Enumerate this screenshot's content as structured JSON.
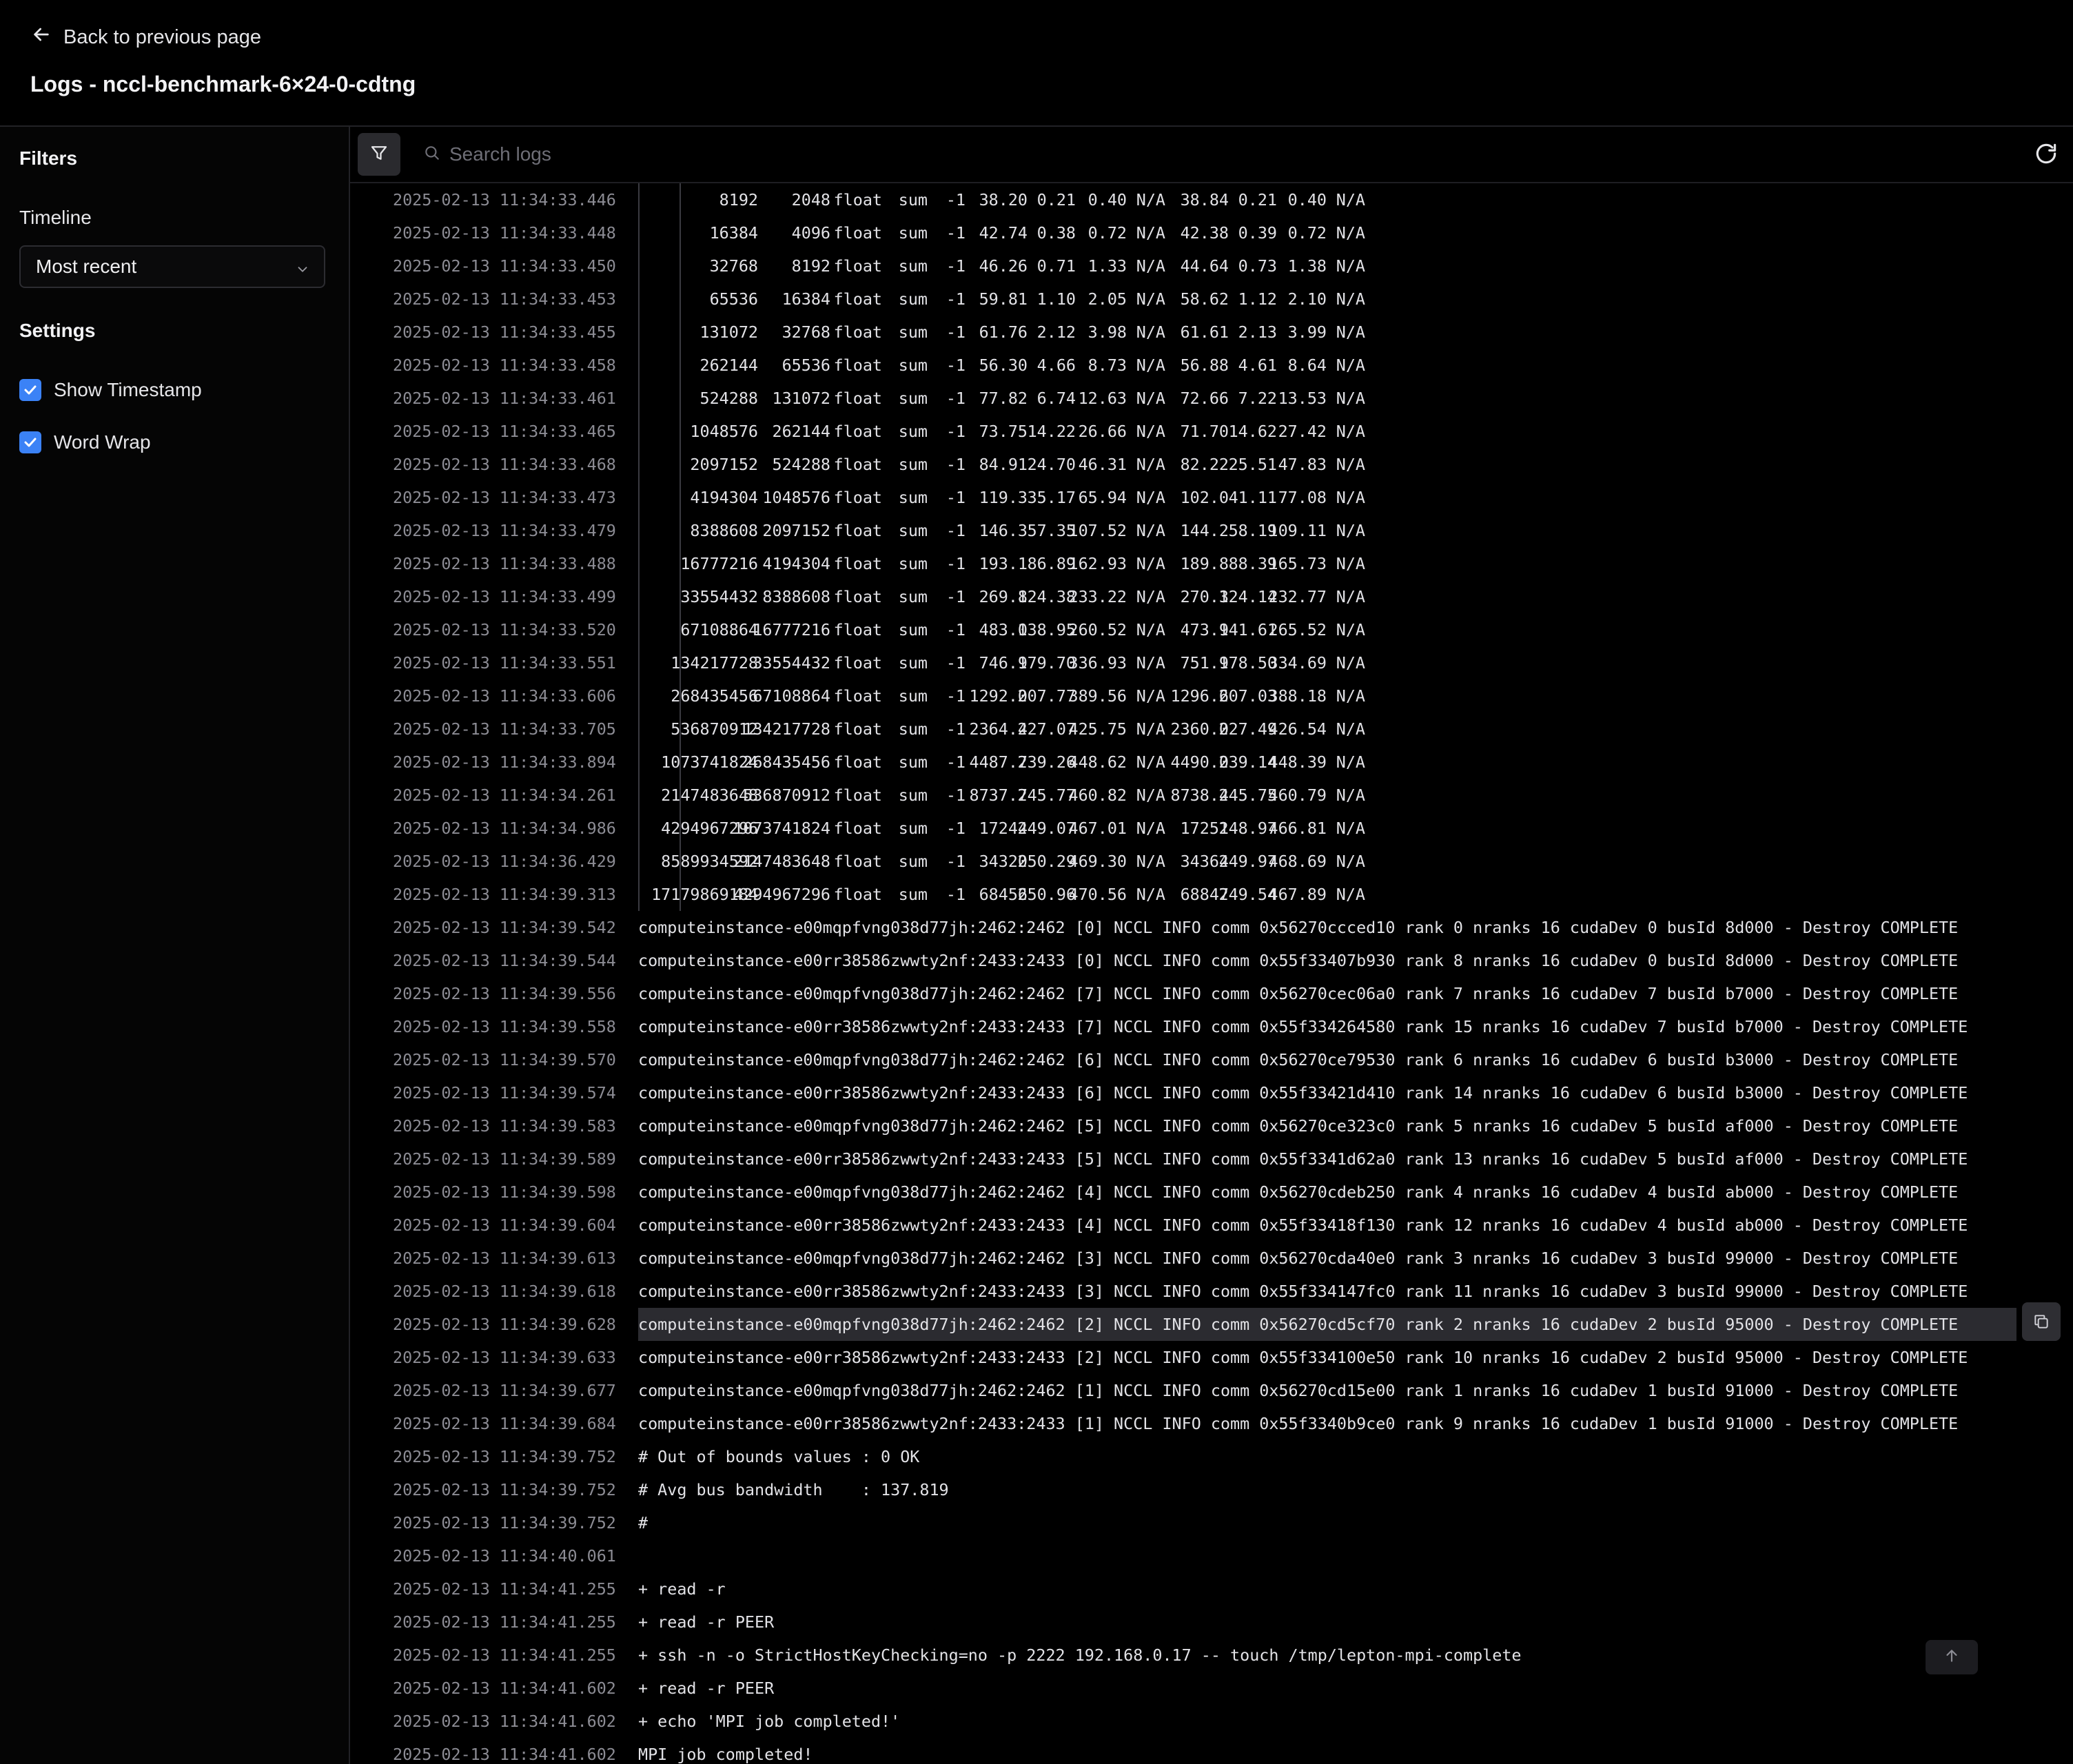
{
  "header": {
    "back_label": "Back to previous page",
    "title": "Logs - nccl-benchmark-6×24-0-cdtng"
  },
  "sidebar": {
    "filters_heading": "Filters",
    "timeline_label": "Timeline",
    "timeline_value": "Most recent",
    "settings_heading": "Settings",
    "show_timestamp": {
      "label": "Show Timestamp",
      "checked": true
    },
    "word_wrap": {
      "label": "Word Wrap",
      "checked": true
    }
  },
  "toolbar": {
    "search_placeholder": "Search logs"
  },
  "icons": [
    "arrow-left-icon",
    "chevron-down-icon",
    "check-icon",
    "filter-icon",
    "search-icon",
    "refresh-icon",
    "copy-icon",
    "arrow-up-icon"
  ],
  "colors": {
    "accent": "#3b82f6",
    "background": "#000000",
    "highlight": "#2b2b30"
  },
  "log_table_rows": [
    [
      "2025-02-13 11:34:33.446",
      "8192",
      "2048",
      "float",
      "sum",
      "-1",
      "38.20",
      "0.21",
      "0.40",
      "N/A",
      "38.84",
      "0.21",
      "0.40",
      "N/A"
    ],
    [
      "2025-02-13 11:34:33.448",
      "16384",
      "4096",
      "float",
      "sum",
      "-1",
      "42.74",
      "0.38",
      "0.72",
      "N/A",
      "42.38",
      "0.39",
      "0.72",
      "N/A"
    ],
    [
      "2025-02-13 11:34:33.450",
      "32768",
      "8192",
      "float",
      "sum",
      "-1",
      "46.26",
      "0.71",
      "1.33",
      "N/A",
      "44.64",
      "0.73",
      "1.38",
      "N/A"
    ],
    [
      "2025-02-13 11:34:33.453",
      "65536",
      "16384",
      "float",
      "sum",
      "-1",
      "59.81",
      "1.10",
      "2.05",
      "N/A",
      "58.62",
      "1.12",
      "2.10",
      "N/A"
    ],
    [
      "2025-02-13 11:34:33.455",
      "131072",
      "32768",
      "float",
      "sum",
      "-1",
      "61.76",
      "2.12",
      "3.98",
      "N/A",
      "61.61",
      "2.13",
      "3.99",
      "N/A"
    ],
    [
      "2025-02-13 11:34:33.458",
      "262144",
      "65536",
      "float",
      "sum",
      "-1",
      "56.30",
      "4.66",
      "8.73",
      "N/A",
      "56.88",
      "4.61",
      "8.64",
      "N/A"
    ],
    [
      "2025-02-13 11:34:33.461",
      "524288",
      "131072",
      "float",
      "sum",
      "-1",
      "77.82",
      "6.74",
      "12.63",
      "N/A",
      "72.66",
      "7.22",
      "13.53",
      "N/A"
    ],
    [
      "2025-02-13 11:34:33.465",
      "1048576",
      "262144",
      "float",
      "sum",
      "-1",
      "73.75",
      "14.22",
      "26.66",
      "N/A",
      "71.70",
      "14.62",
      "27.42",
      "N/A"
    ],
    [
      "2025-02-13 11:34:33.468",
      "2097152",
      "524288",
      "float",
      "sum",
      "-1",
      "84.91",
      "24.70",
      "46.31",
      "N/A",
      "82.22",
      "25.51",
      "47.83",
      "N/A"
    ],
    [
      "2025-02-13 11:34:33.473",
      "4194304",
      "1048576",
      "float",
      "sum",
      "-1",
      "119.3",
      "35.17",
      "65.94",
      "N/A",
      "102.0",
      "41.11",
      "77.08",
      "N/A"
    ],
    [
      "2025-02-13 11:34:33.479",
      "8388608",
      "2097152",
      "float",
      "sum",
      "-1",
      "146.3",
      "57.35",
      "107.52",
      "N/A",
      "144.2",
      "58.19",
      "109.11",
      "N/A"
    ],
    [
      "2025-02-13 11:34:33.488",
      "16777216",
      "4194304",
      "float",
      "sum",
      "-1",
      "193.1",
      "86.89",
      "162.93",
      "N/A",
      "189.8",
      "88.39",
      "165.73",
      "N/A"
    ],
    [
      "2025-02-13 11:34:33.499",
      "33554432",
      "8388608",
      "float",
      "sum",
      "-1",
      "269.8",
      "124.38",
      "233.22",
      "N/A",
      "270.3",
      "124.14",
      "232.77",
      "N/A"
    ],
    [
      "2025-02-13 11:34:33.520",
      "67108864",
      "16777216",
      "float",
      "sum",
      "-1",
      "483.0",
      "138.95",
      "260.52",
      "N/A",
      "473.9",
      "141.61",
      "265.52",
      "N/A"
    ],
    [
      "2025-02-13 11:34:33.551",
      "134217728",
      "33554432",
      "float",
      "sum",
      "-1",
      "746.9",
      "179.70",
      "336.93",
      "N/A",
      "751.9",
      "178.50",
      "334.69",
      "N/A"
    ],
    [
      "2025-02-13 11:34:33.606",
      "268435456",
      "67108864",
      "float",
      "sum",
      "-1",
      "1292.0",
      "207.77",
      "389.56",
      "N/A",
      "1296.6",
      "207.03",
      "388.18",
      "N/A"
    ],
    [
      "2025-02-13 11:34:33.705",
      "536870912",
      "134217728",
      "float",
      "sum",
      "-1",
      "2364.4",
      "227.07",
      "425.75",
      "N/A",
      "2360.0",
      "227.49",
      "426.54",
      "N/A"
    ],
    [
      "2025-02-13 11:34:33.894",
      "1073741824",
      "268435456",
      "float",
      "sum",
      "-1",
      "4487.7",
      "239.26",
      "448.62",
      "N/A",
      "4490.0",
      "239.14",
      "448.39",
      "N/A"
    ],
    [
      "2025-02-13 11:34:34.261",
      "2147483648",
      "536870912",
      "float",
      "sum",
      "-1",
      "8737.7",
      "245.77",
      "460.82",
      "N/A",
      "8738.4",
      "245.75",
      "460.79",
      "N/A"
    ],
    [
      "2025-02-13 11:34:34.986",
      "4294967296",
      "1073741824",
      "float",
      "sum",
      "-1",
      "17244",
      "249.07",
      "467.01",
      "N/A",
      "17251",
      "248.97",
      "466.81",
      "N/A"
    ],
    [
      "2025-02-13 11:34:36.429",
      "8589934592",
      "2147483648",
      "float",
      "sum",
      "-1",
      "34320",
      "250.29",
      "469.30",
      "N/A",
      "34364",
      "249.97",
      "468.69",
      "N/A"
    ],
    [
      "2025-02-13 11:34:39.313",
      "17179869184",
      "4294967296",
      "float",
      "sum",
      "-1",
      "68456",
      "250.96",
      "470.56",
      "N/A",
      "68847",
      "249.54",
      "467.89",
      "N/A"
    ]
  ],
  "log_text_rows": [
    [
      "2025-02-13 11:34:39.542",
      "computeinstance-e00mqpfvng038d77jh:2462:2462 [0] NCCL INFO comm 0x56270ccced10 rank 0 nranks 16 cudaDev 0 busId 8d000 - Destroy COMPLETE"
    ],
    [
      "2025-02-13 11:34:39.544",
      "computeinstance-e00rr38586zwwty2nf:2433:2433 [0] NCCL INFO comm 0x55f33407b930 rank 8 nranks 16 cudaDev 0 busId 8d000 - Destroy COMPLETE"
    ],
    [
      "2025-02-13 11:34:39.556",
      "computeinstance-e00mqpfvng038d77jh:2462:2462 [7] NCCL INFO comm 0x56270cec06a0 rank 7 nranks 16 cudaDev 7 busId b7000 - Destroy COMPLETE"
    ],
    [
      "2025-02-13 11:34:39.558",
      "computeinstance-e00rr38586zwwty2nf:2433:2433 [7] NCCL INFO comm 0x55f334264580 rank 15 nranks 16 cudaDev 7 busId b7000 - Destroy COMPLETE"
    ],
    [
      "2025-02-13 11:34:39.570",
      "computeinstance-e00mqpfvng038d77jh:2462:2462 [6] NCCL INFO comm 0x56270ce79530 rank 6 nranks 16 cudaDev 6 busId b3000 - Destroy COMPLETE"
    ],
    [
      "2025-02-13 11:34:39.574",
      "computeinstance-e00rr38586zwwty2nf:2433:2433 [6] NCCL INFO comm 0x55f33421d410 rank 14 nranks 16 cudaDev 6 busId b3000 - Destroy COMPLETE"
    ],
    [
      "2025-02-13 11:34:39.583",
      "computeinstance-e00mqpfvng038d77jh:2462:2462 [5] NCCL INFO comm 0x56270ce323c0 rank 5 nranks 16 cudaDev 5 busId af000 - Destroy COMPLETE"
    ],
    [
      "2025-02-13 11:34:39.589",
      "computeinstance-e00rr38586zwwty2nf:2433:2433 [5] NCCL INFO comm 0x55f3341d62a0 rank 13 nranks 16 cudaDev 5 busId af000 - Destroy COMPLETE"
    ],
    [
      "2025-02-13 11:34:39.598",
      "computeinstance-e00mqpfvng038d77jh:2462:2462 [4] NCCL INFO comm 0x56270cdeb250 rank 4 nranks 16 cudaDev 4 busId ab000 - Destroy COMPLETE"
    ],
    [
      "2025-02-13 11:34:39.604",
      "computeinstance-e00rr38586zwwty2nf:2433:2433 [4] NCCL INFO comm 0x55f33418f130 rank 12 nranks 16 cudaDev 4 busId ab000 - Destroy COMPLETE"
    ],
    [
      "2025-02-13 11:34:39.613",
      "computeinstance-e00mqpfvng038d77jh:2462:2462 [3] NCCL INFO comm 0x56270cda40e0 rank 3 nranks 16 cudaDev 3 busId 99000 - Destroy COMPLETE"
    ],
    [
      "2025-02-13 11:34:39.618",
      "computeinstance-e00rr38586zwwty2nf:2433:2433 [3] NCCL INFO comm 0x55f334147fc0 rank 11 nranks 16 cudaDev 3 busId 99000 - Destroy COMPLETE"
    ],
    [
      "2025-02-13 11:34:39.628",
      "computeinstance-e00mqpfvng038d77jh:2462:2462 [2] NCCL INFO comm 0x56270cd5cf70 rank 2 nranks 16 cudaDev 2 busId 95000 - Destroy COMPLETE"
    ],
    [
      "2025-02-13 11:34:39.633",
      "computeinstance-e00rr38586zwwty2nf:2433:2433 [2] NCCL INFO comm 0x55f334100e50 rank 10 nranks 16 cudaDev 2 busId 95000 - Destroy COMPLETE"
    ],
    [
      "2025-02-13 11:34:39.677",
      "computeinstance-e00mqpfvng038d77jh:2462:2462 [1] NCCL INFO comm 0x56270cd15e00 rank 1 nranks 16 cudaDev 1 busId 91000 - Destroy COMPLETE"
    ],
    [
      "2025-02-13 11:34:39.684",
      "computeinstance-e00rr38586zwwty2nf:2433:2433 [1] NCCL INFO comm 0x55f3340b9ce0 rank 9 nranks 16 cudaDev 1 busId 91000 - Destroy COMPLETE"
    ],
    [
      "2025-02-13 11:34:39.752",
      "# Out of bounds values : 0 OK"
    ],
    [
      "2025-02-13 11:34:39.752",
      "# Avg bus bandwidth    : 137.819"
    ],
    [
      "2025-02-13 11:34:39.752",
      "#"
    ],
    [
      "2025-02-13 11:34:40.061",
      ""
    ],
    [
      "2025-02-13 11:34:41.255",
      "+ read -r"
    ],
    [
      "2025-02-13 11:34:41.255",
      "+ read -r PEER"
    ],
    [
      "2025-02-13 11:34:41.255",
      "+ ssh -n -o StrictHostKeyChecking=no -p 2222 192.168.0.17 -- touch /tmp/lepton-mpi-complete"
    ],
    [
      "2025-02-13 11:34:41.602",
      "+ read -r PEER"
    ],
    [
      "2025-02-13 11:34:41.602",
      "+ echo 'MPI job completed!'"
    ],
    [
      "2025-02-13 11:34:41.602",
      "MPI job completed!"
    ]
  ],
  "highlighted_text_row": 12
}
